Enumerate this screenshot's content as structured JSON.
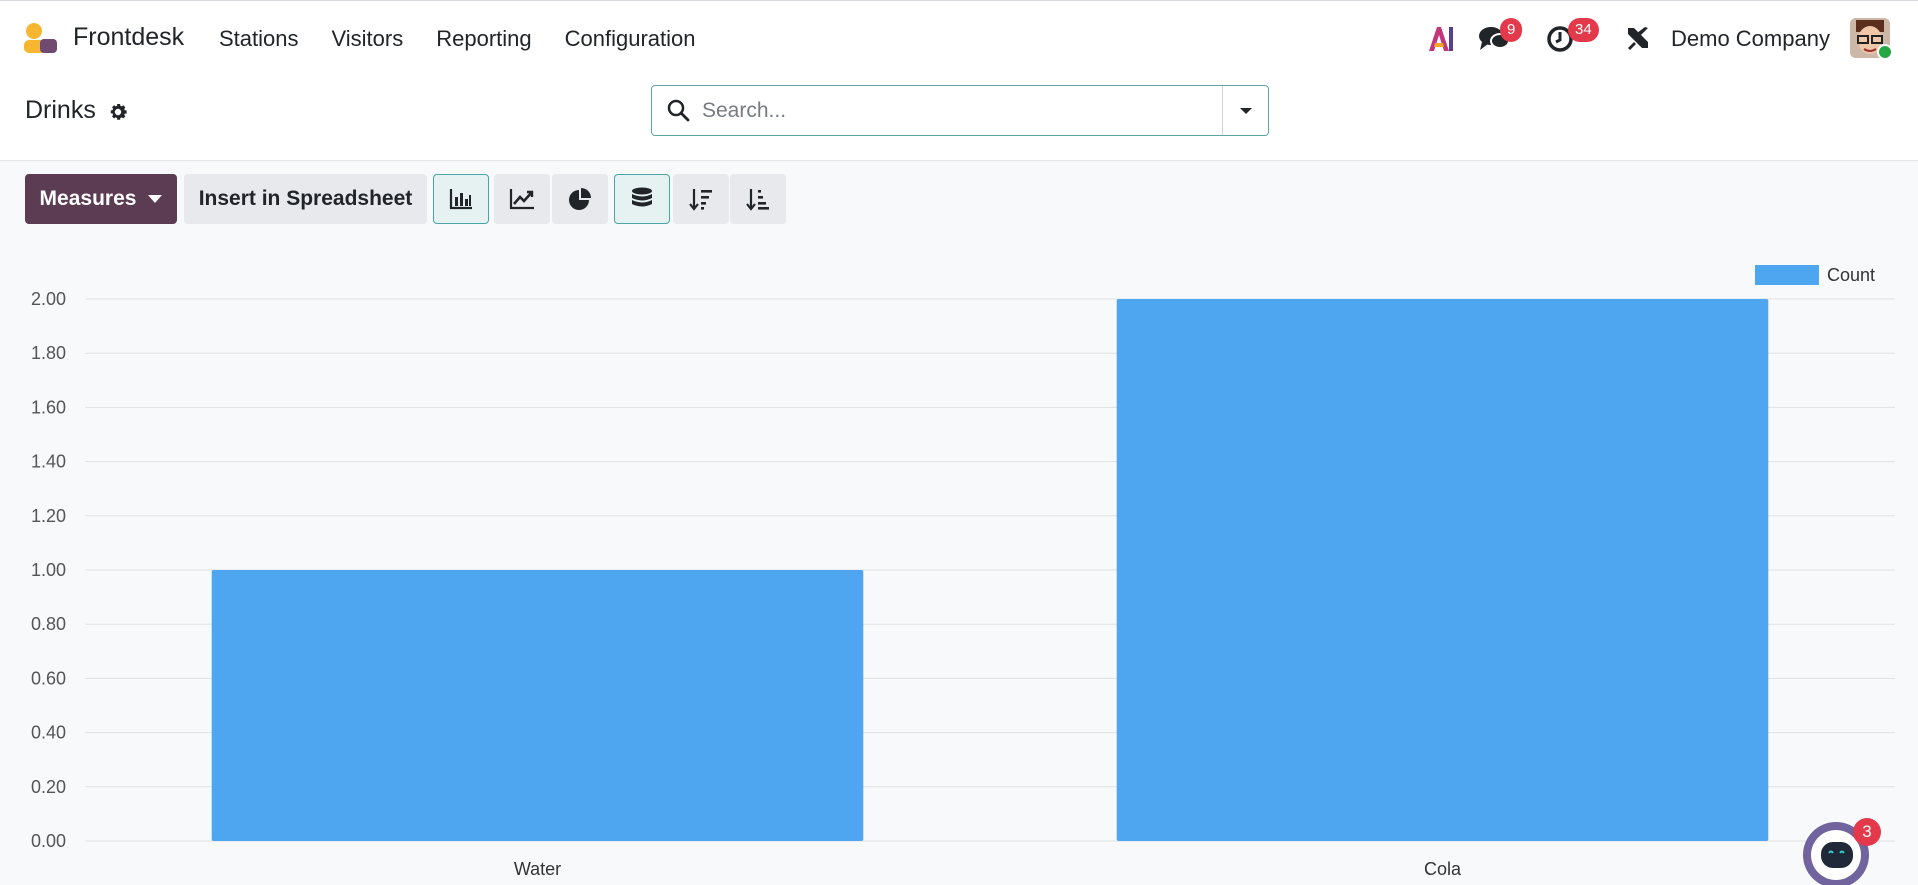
{
  "navbar": {
    "app_name": "Frontdesk",
    "menu": [
      "Stations",
      "Visitors",
      "Reporting",
      "Configuration"
    ],
    "messages_count": "9",
    "activities_count": "34",
    "company": "Demo Company",
    "ai_label": "AI"
  },
  "control_panel": {
    "title": "Drinks",
    "search_placeholder": "Search..."
  },
  "toolbar": {
    "measures_label": "Measures",
    "insert_label": "Insert in Spreadsheet",
    "icons": [
      "bar-chart-icon",
      "line-chart-icon",
      "pie-chart-icon",
      "stacked-database-icon",
      "sort-descending-icon",
      "sort-ascending-icon"
    ],
    "active": [
      "bar-chart-icon",
      "stacked-database-icon"
    ]
  },
  "chart_data": {
    "type": "bar",
    "categories": [
      "Water",
      "Cola"
    ],
    "series": [
      {
        "name": "Count",
        "values": [
          1,
          2
        ],
        "color": "#4fa6f0"
      }
    ],
    "ylim": [
      0,
      2
    ],
    "yticks": [
      "0.00",
      "0.20",
      "0.40",
      "0.60",
      "0.80",
      "1.00",
      "1.20",
      "1.40",
      "1.60",
      "1.80",
      "2.00"
    ],
    "legend_position": "top-right",
    "grid": true
  },
  "chatbot": {
    "badge": "3"
  },
  "colors": {
    "primary": "#5c3c53",
    "accent": "#4aa5a5",
    "bar": "#4fa6f0",
    "badge": "#e4394b"
  }
}
